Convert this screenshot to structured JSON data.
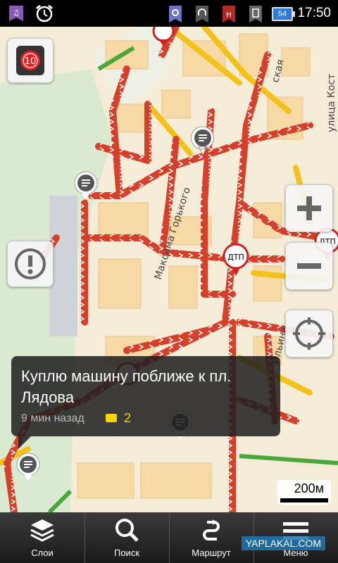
{
  "status_bar": {
    "time": "17:50",
    "battery": "54",
    "icons": [
      "media-icon",
      "alarm-icon",
      "gps-icon",
      "headset-icon",
      "network-icon",
      "vibrate-icon"
    ]
  },
  "map": {
    "labels": {
      "dtp": "ДТП"
    }
  },
  "popup": {
    "title": "Куплю машину поближе к пл. Лядова",
    "time_ago": "9 мин назад",
    "comments": "2"
  },
  "traffic_level": "10",
  "scale": "200м",
  "bottom_nav": [
    {
      "label": "Слои",
      "icon": "layers-icon"
    },
    {
      "label": "Поиск",
      "icon": "search-icon"
    },
    {
      "label": "Маршрут",
      "icon": "route-icon"
    },
    {
      "label": "Меню",
      "icon": "menu-icon"
    }
  ],
  "watermark": "YAPLAKAL.COM",
  "colors": {
    "jam": "#d6402a",
    "slow": "#f2c21a",
    "free": "#4aa83a",
    "map_bg": "#f4ecd6"
  }
}
